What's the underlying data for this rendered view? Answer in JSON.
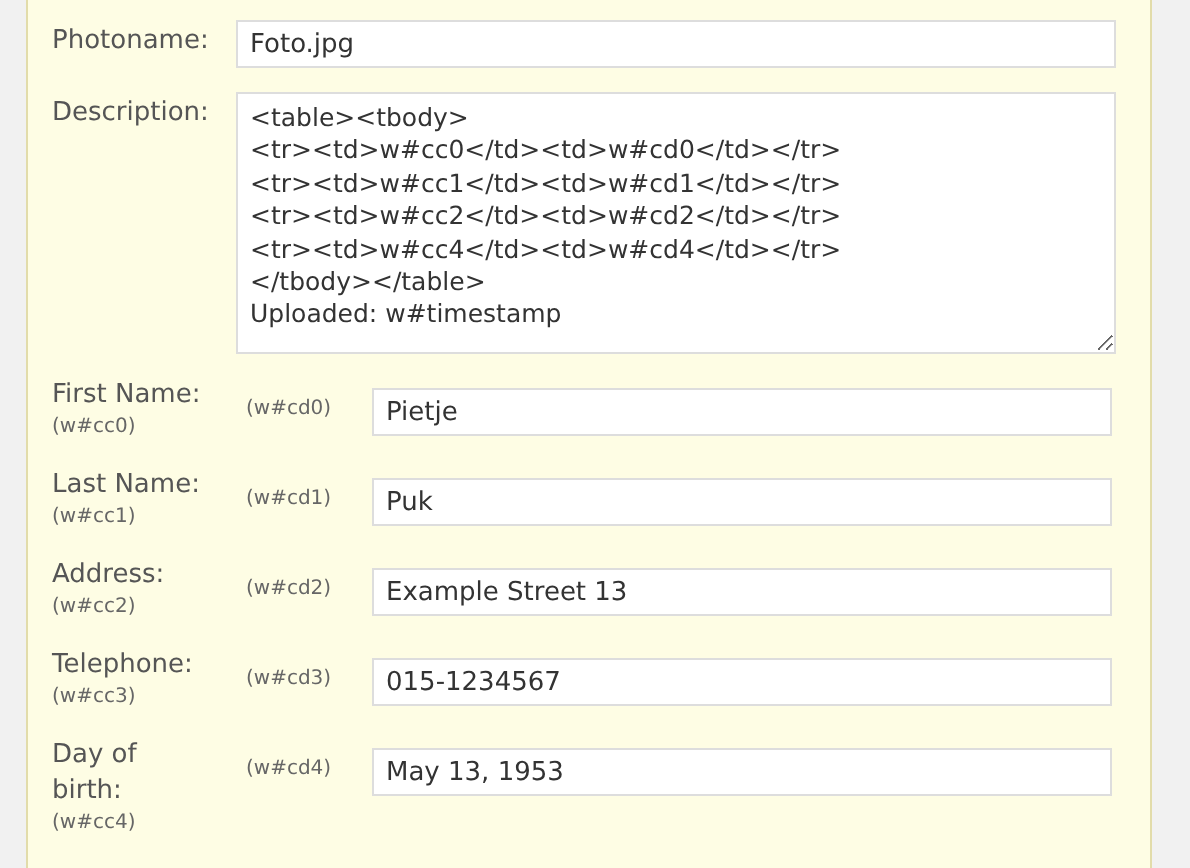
{
  "photoname": {
    "label": "Photoname:",
    "value": "Foto.jpg"
  },
  "description": {
    "label": "Description:",
    "value": "<table><tbody>\n<tr><td>w#cc0</td><td>w#cd0</td></tr>\n<tr><td>w#cc1</td><td>w#cd1</td></tr>\n<tr><td>w#cc2</td><td>w#cd2</td></tr>\n<tr><td>w#cc4</td><td>w#cd4</td></tr>\n</tbody></table>\nUploaded: w#timestamp"
  },
  "fields": [
    {
      "label": "First Name:",
      "label_code": "(w#cc0)",
      "value_code": "(w#cd0)",
      "value": "Pietje"
    },
    {
      "label": "Last Name:",
      "label_code": "(w#cc1)",
      "value_code": "(w#cd1)",
      "value": "Puk"
    },
    {
      "label": "Address:",
      "label_code": "(w#cc2)",
      "value_code": "(w#cd2)",
      "value": "Example Street 13"
    },
    {
      "label": "Telephone:",
      "label_code": "(w#cc3)",
      "value_code": "(w#cd3)",
      "value": "015-1234567"
    },
    {
      "label": "Day of birth:",
      "label_code": "(w#cc4)",
      "value_code": "(w#cd4)",
      "value": "May 13, 1953"
    }
  ]
}
